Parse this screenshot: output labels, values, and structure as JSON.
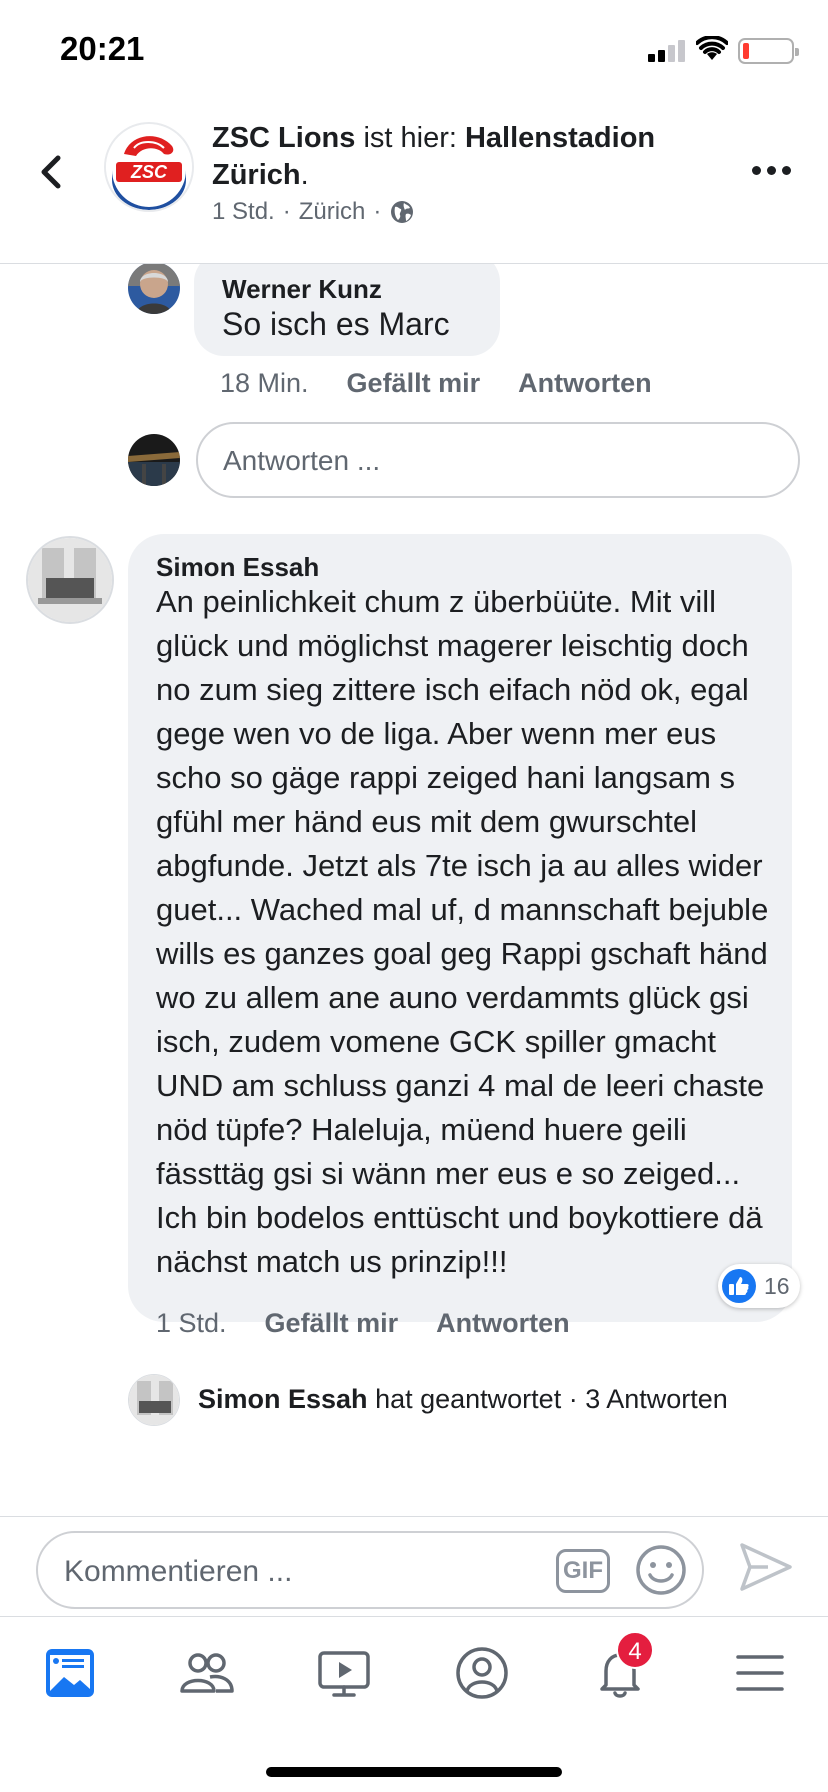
{
  "status_bar": {
    "time": "20:21"
  },
  "header": {
    "page_name": "ZSC Lions",
    "check_in_text": " ist hier: ",
    "location_bold": "Hallenstadion Zürich",
    "location_period": ".",
    "meta_time": "1 Std.",
    "meta_separator": "·",
    "meta_place": "Zürich",
    "icons": [
      "back-chevron-icon",
      "globe-icon",
      "more-icon"
    ]
  },
  "comments": [
    {
      "author": "Werner Kunz",
      "text": "So isch es Marc",
      "time": "18 Min.",
      "like_label": "Gefällt mir",
      "reply_label": "Antworten"
    },
    {
      "author": "Simon Essah",
      "text": "An peinlichkeit chum z überbüüte. Mit vill glück und möglichst magerer leischtig doch no zum sieg zittere isch eifach nöd ok, egal gege wen vo de liga. Aber wenn mer eus scho so gäge rappi zeiged hani langsam s gfühl mer händ eus mit dem gwurschtel abgfunde. Jetzt als 7te isch ja au alles wider guet... Wached mal uf, d mannschaft bejuble wills es ganzes goal geg Rappi gschaft händ wo zu allem ane auno verdammts glück gsi isch, zudem vomene GCK spiller gmacht UND am schluss ganzi 4 mal de leeri chaste nöd tüpfe? Haleluja, müend huere geili fässttäg gsi si wänn mer eus e so zeiged... Ich bin bodelos enttüscht und boykottiere dä nächst match us prinzip!!!",
      "time": "1 Std.",
      "like_label": "Gefällt mir",
      "reply_label": "Antworten",
      "reaction_count": "16"
    }
  ],
  "reply_input_placeholder": "Antworten ...",
  "replies_summary": {
    "author": "Simon Essah",
    "action": " hat geantwortet",
    "separator": " · ",
    "count": "3 Antworten"
  },
  "composer": {
    "placeholder": "Kommentieren ...",
    "gif_label": "GIF"
  },
  "tabbar": {
    "tabs": [
      "news-feed-icon",
      "friends-icon",
      "watch-icon",
      "profile-icon",
      "notifications-icon",
      "menu-icon"
    ],
    "notifications_badge": "4"
  },
  "colors": {
    "accent": "#1877f2",
    "bubble": "#eff1f4",
    "badge": "#e41e3f",
    "secondary_text": "#606770"
  }
}
